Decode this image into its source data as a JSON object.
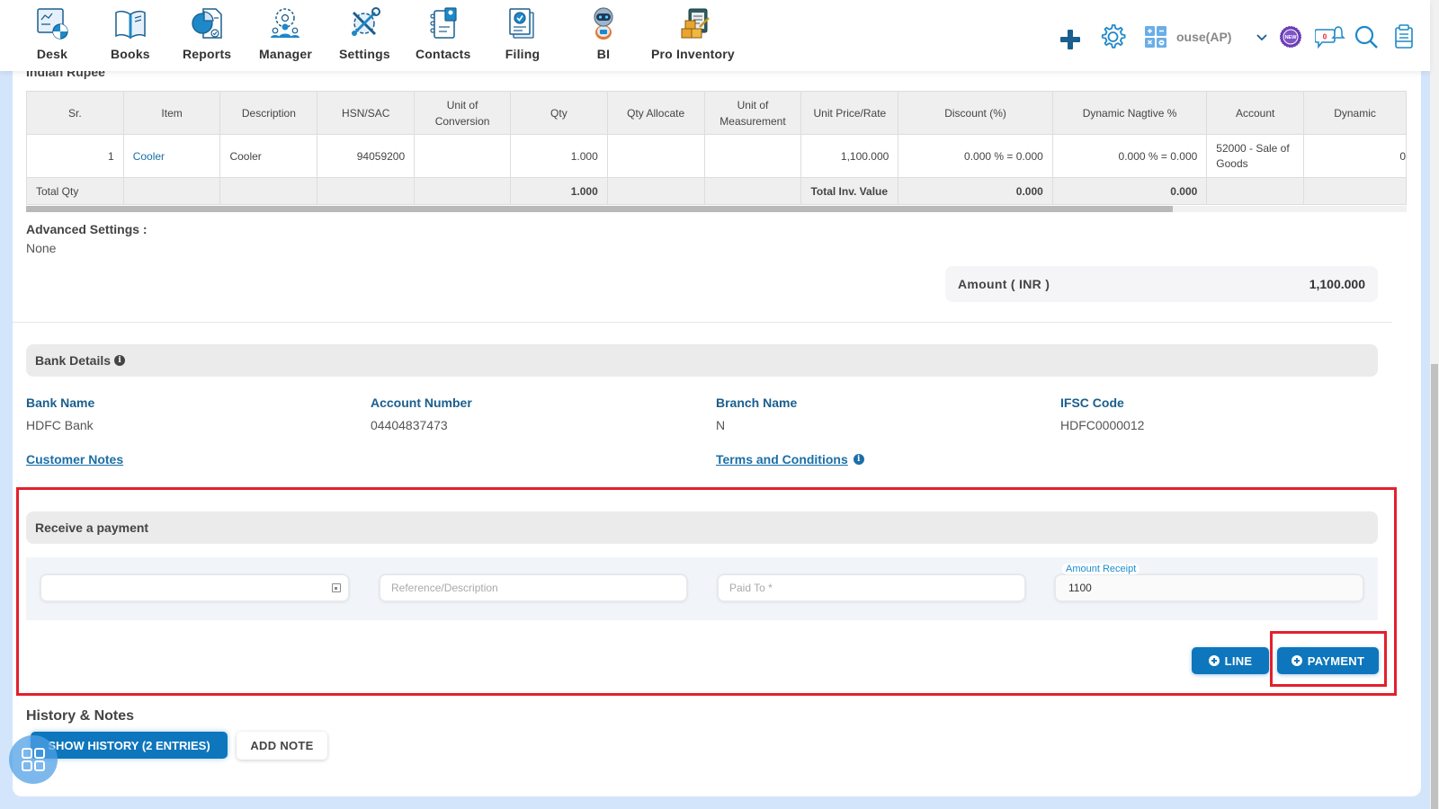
{
  "nav": {
    "items": [
      {
        "label": "Desk",
        "icon": "desk-icon"
      },
      {
        "label": "Books",
        "icon": "books-icon"
      },
      {
        "label": "Reports",
        "icon": "reports-icon"
      },
      {
        "label": "Manager",
        "icon": "manager-icon"
      },
      {
        "label": "Settings",
        "icon": "settings-tools-icon"
      },
      {
        "label": "Contacts",
        "icon": "contacts-icon"
      },
      {
        "label": "Filing",
        "icon": "filing-icon"
      },
      {
        "label": "BI",
        "icon": "bi-robot-icon"
      },
      {
        "label": "Pro Inventory",
        "icon": "pro-inventory-icon"
      }
    ],
    "company": "ouse(AP)",
    "notification_count": "0",
    "new_badge": "NEW"
  },
  "invoice": {
    "currency": "Indian Rupee",
    "table": {
      "headers": [
        "Sr.",
        "Item",
        "Description",
        "HSN/SAC",
        "Unit of Conversion",
        "Qty",
        "Qty Allocate",
        "Unit of Measurement",
        "Unit Price/Rate",
        "Discount (%)",
        "Dynamic Nagtive %",
        "Account",
        "Dynamic"
      ],
      "rows": [
        {
          "sr": "1",
          "item": "Cooler",
          "description": "Cooler",
          "hsn": "94059200",
          "uoc": "",
          "qty": "1.000",
          "qty_allocate": "",
          "uom": "",
          "rate": "1,100.000",
          "discount": "0.000 % = 0.000",
          "dyn_neg": "0.000 % = 0.000",
          "account": "52000 - Sale of Goods",
          "dynamic": "0"
        }
      ],
      "total": {
        "label": "Total Qty",
        "qty": "1.000",
        "inv_label": "Total Inv. Value",
        "discount": "0.000",
        "dyn_neg": "0.000"
      }
    },
    "advanced_settings_label": "Advanced Settings :",
    "advanced_settings_value": "None",
    "amount_label": "Amount ( INR )",
    "amount_value": "1,100.000"
  },
  "bank": {
    "title": "Bank Details",
    "fields": [
      {
        "label": "Bank Name",
        "value": "HDFC Bank"
      },
      {
        "label": "Account Number",
        "value": "04404837473"
      },
      {
        "label": "Branch Name",
        "value": "N"
      },
      {
        "label": "IFSC Code",
        "value": "HDFC0000012"
      }
    ],
    "customer_notes": "Customer Notes",
    "terms": "Terms and Conditions"
  },
  "payment": {
    "title": "Receive a payment",
    "date_value": "",
    "reference_placeholder": "Reference/Description",
    "paid_to_placeholder": "Paid To *",
    "amount_label": "Amount Receipt",
    "amount_value": "1100",
    "line_button": "LINE",
    "payment_button": "PAYMENT"
  },
  "history": {
    "title": "History & Notes",
    "show_button": "SHOW HISTORY (2 ENTRIES)",
    "add_note_button": "ADD NOTE"
  }
}
